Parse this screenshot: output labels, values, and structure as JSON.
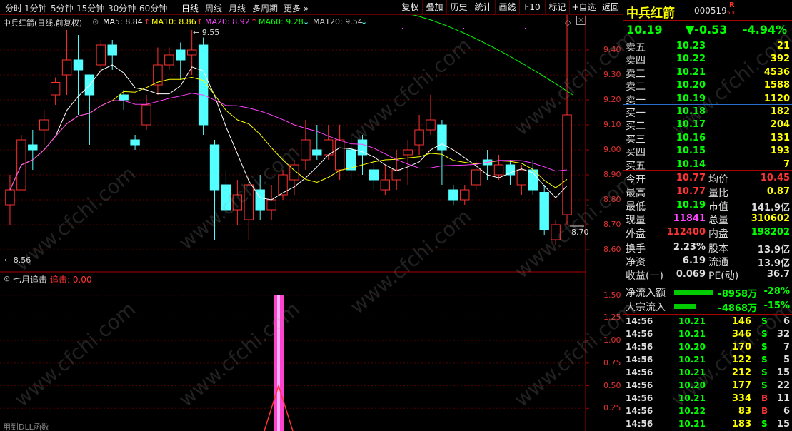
{
  "toolbar": {
    "periods": [
      "分时",
      "1分钟",
      "5分钟",
      "15分钟",
      "30分钟",
      "60分钟",
      "日线",
      "周线",
      "月线",
      "多周期",
      "更多"
    ],
    "buttons": [
      "复权",
      "叠加",
      "历史",
      "统计",
      "画线",
      "F10",
      "标记",
      "+自选",
      "返回"
    ]
  },
  "chart_header": {
    "title": "中兵红箭(日线,前复权)",
    "ma5": "MA5: 8.84",
    "ma10": "MA10: 8.86",
    "ma20": "MA20: 8.92",
    "ma60": "MA60: 9.28",
    "ma120": "MA120: 9.54"
  },
  "colors": {
    "ma5": "#ffffff",
    "ma10": "#ffff00",
    "ma20": "#ff40ff",
    "ma60": "#00ff00",
    "ma120": "#aaaaaa",
    "up": "#ff3030",
    "down": "#54ffff"
  },
  "price_axis": [
    "9.40",
    "9.30",
    "9.20",
    "9.10",
    "9.00",
    "8.90",
    "8.80",
    "8.70",
    "8.60"
  ],
  "annotations": {
    "high": "9.55",
    "low": "8.56",
    "last": "8.70"
  },
  "indicator": {
    "name": "七月追击",
    "label": "追击: 0.00",
    "axis": [
      "1.50",
      "1.25",
      "1.00",
      "0.75",
      "0.50",
      "0.25"
    ],
    "footer": "用到DLL函数"
  },
  "chart_data": {
    "type": "candlestick",
    "ylim": [
      8.52,
      9.62
    ],
    "candles": [
      [
        8.78,
        8.84,
        8.7,
        8.9
      ],
      [
        8.84,
        9.04,
        8.84,
        9.06
      ],
      [
        9.02,
        9.0,
        8.92,
        9.08
      ],
      [
        9.08,
        9.12,
        9.02,
        9.16
      ],
      [
        9.22,
        9.27,
        9.18,
        9.29
      ],
      [
        9.3,
        9.36,
        9.22,
        9.48
      ],
      [
        9.36,
        9.32,
        9.14,
        9.46
      ],
      [
        9.3,
        9.22,
        9.02,
        9.3
      ],
      [
        9.34,
        9.42,
        9.3,
        9.44
      ],
      [
        9.42,
        9.38,
        9.32,
        9.44
      ],
      [
        9.22,
        9.2,
        9.16,
        9.24
      ],
      [
        9.04,
        9.02,
        9.0,
        9.06
      ],
      [
        9.1,
        9.18,
        9.08,
        9.22
      ],
      [
        9.26,
        9.34,
        9.22,
        9.41
      ],
      [
        9.34,
        9.38,
        9.32,
        9.41
      ],
      [
        9.4,
        9.36,
        9.28,
        9.43
      ],
      [
        9.38,
        9.4,
        9.3,
        9.48
      ],
      [
        9.42,
        9.1,
        9.06,
        9.45
      ],
      [
        9.02,
        8.84,
        8.64,
        9.04
      ],
      [
        8.86,
        8.76,
        8.74,
        8.92
      ],
      [
        8.76,
        8.82,
        8.7,
        8.88
      ],
      [
        8.72,
        8.86,
        8.64,
        8.9
      ],
      [
        8.84,
        8.76,
        8.72,
        8.9
      ],
      [
        8.76,
        8.8,
        8.72,
        8.86
      ],
      [
        8.82,
        8.9,
        8.8,
        8.92
      ],
      [
        8.88,
        8.94,
        8.82,
        8.96
      ],
      [
        8.96,
        9.04,
        8.92,
        9.12
      ],
      [
        9.0,
        8.98,
        8.96,
        9.1
      ],
      [
        8.98,
        9.04,
        8.96,
        9.1
      ],
      [
        8.92,
        9.04,
        8.88,
        9.1
      ],
      [
        9.0,
        8.92,
        8.88,
        9.06
      ],
      [
        9.04,
        8.98,
        8.9,
        9.06
      ],
      [
        8.92,
        8.88,
        8.84,
        8.96
      ],
      [
        8.84,
        8.88,
        8.82,
        8.94
      ],
      [
        8.88,
        8.92,
        8.84,
        9.0
      ],
      [
        8.98,
        9.0,
        8.86,
        9.04
      ],
      [
        9.02,
        9.08,
        8.98,
        9.14
      ],
      [
        9.08,
        9.12,
        9.06,
        9.22
      ],
      [
        9.1,
        9.0,
        8.86,
        9.12
      ],
      [
        8.84,
        8.8,
        8.78,
        8.86
      ],
      [
        8.8,
        8.84,
        8.78,
        8.86
      ],
      [
        8.86,
        8.92,
        8.84,
        8.96
      ],
      [
        8.96,
        8.94,
        8.88,
        9.0
      ],
      [
        8.9,
        8.94,
        8.88,
        8.98
      ],
      [
        8.94,
        8.9,
        8.86,
        8.96
      ],
      [
        8.86,
        8.92,
        8.82,
        8.94
      ],
      [
        8.92,
        8.84,
        8.82,
        8.96
      ],
      [
        8.83,
        8.68,
        8.66,
        8.86
      ],
      [
        8.64,
        8.7,
        8.62,
        8.72
      ],
      [
        8.74,
        9.14,
        8.7,
        9.54
      ]
    ]
  },
  "quote": {
    "name": "中兵红箭",
    "code": "000519",
    "badge": "R",
    "badge2": "500",
    "price": "10.19",
    "change": "▼-0.53",
    "pct": "-4.94%",
    "asks": [
      [
        "卖五",
        "10.23",
        "21"
      ],
      [
        "卖四",
        "10.22",
        "392"
      ],
      [
        "卖三",
        "10.21",
        "4536"
      ],
      [
        "卖二",
        "10.20",
        "1588"
      ],
      [
        "卖一",
        "10.19",
        "1120"
      ]
    ],
    "bids": [
      [
        "买一",
        "10.18",
        "182"
      ],
      [
        "买二",
        "10.17",
        "204"
      ],
      [
        "买三",
        "10.16",
        "131"
      ],
      [
        "买四",
        "10.15",
        "193"
      ],
      [
        "买五",
        "10.14",
        "7"
      ]
    ],
    "stats": [
      [
        "今开",
        "10.77",
        "均价",
        "10.45"
      ],
      [
        "最高",
        "10.77",
        "量比",
        "0.87"
      ],
      [
        "最低",
        "10.19",
        "市值",
        "141.9亿"
      ],
      [
        "现量",
        "11841",
        "总量",
        "310602"
      ],
      [
        "外盘",
        "112400",
        "内盘",
        "198202"
      ]
    ],
    "stats2": [
      [
        "换手",
        "2.23%",
        "股本",
        "13.9亿"
      ],
      [
        "净资",
        "6.19",
        "流通",
        "13.9亿"
      ],
      [
        "收益(一)",
        "0.069",
        "PE(动)",
        "36.7"
      ]
    ],
    "flows": [
      [
        "净流入额",
        "-8958万",
        "-28%"
      ],
      [
        "大宗流入",
        "-4868万",
        "-15%"
      ]
    ],
    "ticks": [
      [
        "14:56",
        "10.21",
        "146",
        "S",
        "6"
      ],
      [
        "14:56",
        "10.21",
        "346",
        "S",
        "32"
      ],
      [
        "14:56",
        "10.20",
        "170",
        "S",
        "7"
      ],
      [
        "14:56",
        "10.21",
        "122",
        "S",
        "5"
      ],
      [
        "14:56",
        "10.21",
        "212",
        "S",
        "15"
      ],
      [
        "14:56",
        "10.20",
        "177",
        "S",
        "22"
      ],
      [
        "14:56",
        "10.21",
        "334",
        "B",
        "11"
      ],
      [
        "14:56",
        "10.22",
        "83",
        "B",
        "6"
      ],
      [
        "14:56",
        "10.21",
        "183",
        "S",
        "15"
      ]
    ]
  },
  "watermark": "www.cfchi.com"
}
